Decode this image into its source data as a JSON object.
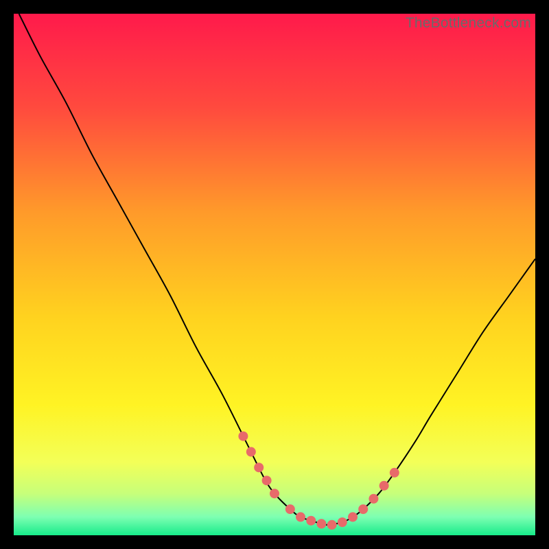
{
  "watermark": "TheBottleneck.com",
  "chart_data": {
    "type": "line",
    "title": "",
    "xlabel": "",
    "ylabel": "",
    "xlim": [
      0,
      100
    ],
    "ylim": [
      0,
      100
    ],
    "background_gradient": {
      "stops": [
        {
          "offset": 0.0,
          "color": "#ff1a4b"
        },
        {
          "offset": 0.18,
          "color": "#ff4a3e"
        },
        {
          "offset": 0.38,
          "color": "#ff9a2a"
        },
        {
          "offset": 0.58,
          "color": "#ffd21f"
        },
        {
          "offset": 0.75,
          "color": "#fff324"
        },
        {
          "offset": 0.86,
          "color": "#f3ff58"
        },
        {
          "offset": 0.92,
          "color": "#c7ff7a"
        },
        {
          "offset": 0.965,
          "color": "#7dffb2"
        },
        {
          "offset": 1.0,
          "color": "#17eb8a"
        }
      ]
    },
    "series": [
      {
        "name": "bottleneck-curve",
        "type": "line",
        "color": "#000000",
        "x": [
          1,
          5,
          10,
          15,
          20,
          25,
          30,
          35,
          40,
          45,
          48,
          50,
          53,
          55,
          58,
          60,
          63,
          65,
          67,
          70,
          73,
          77,
          80,
          85,
          90,
          95,
          100
        ],
        "y": [
          100,
          92,
          83,
          73,
          64,
          55,
          46,
          36,
          27,
          17,
          11,
          8,
          5,
          3.5,
          2.5,
          2,
          2.5,
          3.5,
          5,
          8,
          12,
          18,
          23,
          31,
          39,
          46,
          53
        ]
      },
      {
        "name": "highlight-points",
        "type": "scatter",
        "color": "#e86a6a",
        "radius": 7,
        "x": [
          44,
          45.5,
          47,
          48.5,
          50,
          53,
          55,
          57,
          59,
          61,
          63,
          65,
          67,
          69,
          71,
          73
        ],
        "y": [
          19,
          16,
          13,
          10.5,
          8,
          5,
          3.5,
          2.8,
          2.2,
          2,
          2.5,
          3.5,
          5,
          7,
          9.5,
          12
        ]
      }
    ]
  }
}
